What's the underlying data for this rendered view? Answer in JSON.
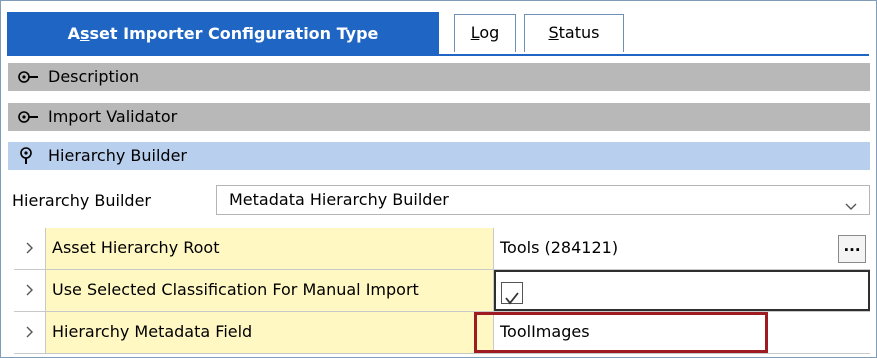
{
  "tabs": {
    "active_prefix": "A",
    "active_underlined": "s",
    "active_rest": "set Importer Configuration Type",
    "log_underlined": "L",
    "log_rest": "og",
    "status_underlined": "S",
    "status_rest": "tatus"
  },
  "sections": [
    {
      "label": "Description",
      "state": "collapsed",
      "icon": "key-icon"
    },
    {
      "label": "Import Validator",
      "state": "collapsed",
      "icon": "key-icon"
    },
    {
      "label": "Hierarchy Builder",
      "state": "expanded",
      "icon": "pin-icon"
    }
  ],
  "hierarchy_builder": {
    "label": "Hierarchy Builder",
    "selected": "Metadata Hierarchy Builder"
  },
  "grid": {
    "rows": [
      {
        "label": "Asset Hierarchy Root",
        "value": "Tools (284121)",
        "button": "..."
      },
      {
        "label": "Use Selected Classification For Manual Import",
        "checked": true
      },
      {
        "label": "Hierarchy Metadata Field",
        "value": "ToolImages"
      }
    ]
  },
  "colors": {
    "tab_active": "#1f66c4",
    "section_gray": "#b8b8b8",
    "section_blue": "#b9cfee",
    "label_cell": "#fff8c2",
    "highlight_box": "#9e1b22"
  }
}
